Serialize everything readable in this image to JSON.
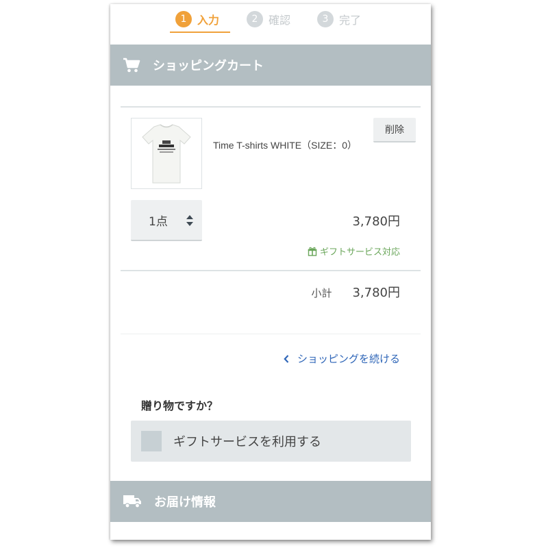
{
  "steps": [
    {
      "number": "1",
      "label": "入力"
    },
    {
      "number": "2",
      "label": "確認"
    },
    {
      "number": "3",
      "label": "完了"
    }
  ],
  "cart_section": {
    "title": "ショッピングカート",
    "icon": "cart-icon"
  },
  "item": {
    "name": "Time T-shirts WHITE（SIZE：0）",
    "delete_label": "削除",
    "quantity": "1点",
    "price": "3,780円",
    "gift_note": "ギフトサービス対応"
  },
  "subtotal": {
    "label": "小計",
    "value": "3,780円"
  },
  "continue_link": "ショッピングを続ける",
  "gift": {
    "question": "贈り物ですか？",
    "option_label": "ギフトサービスを利用する"
  },
  "delivery_section": {
    "title": "お届け情報",
    "icon": "truck-icon"
  },
  "colors": {
    "accent": "#f0a13a",
    "header_bg": "#b3bec2",
    "link": "#2f66b8",
    "gift_green": "#6aa65a"
  }
}
